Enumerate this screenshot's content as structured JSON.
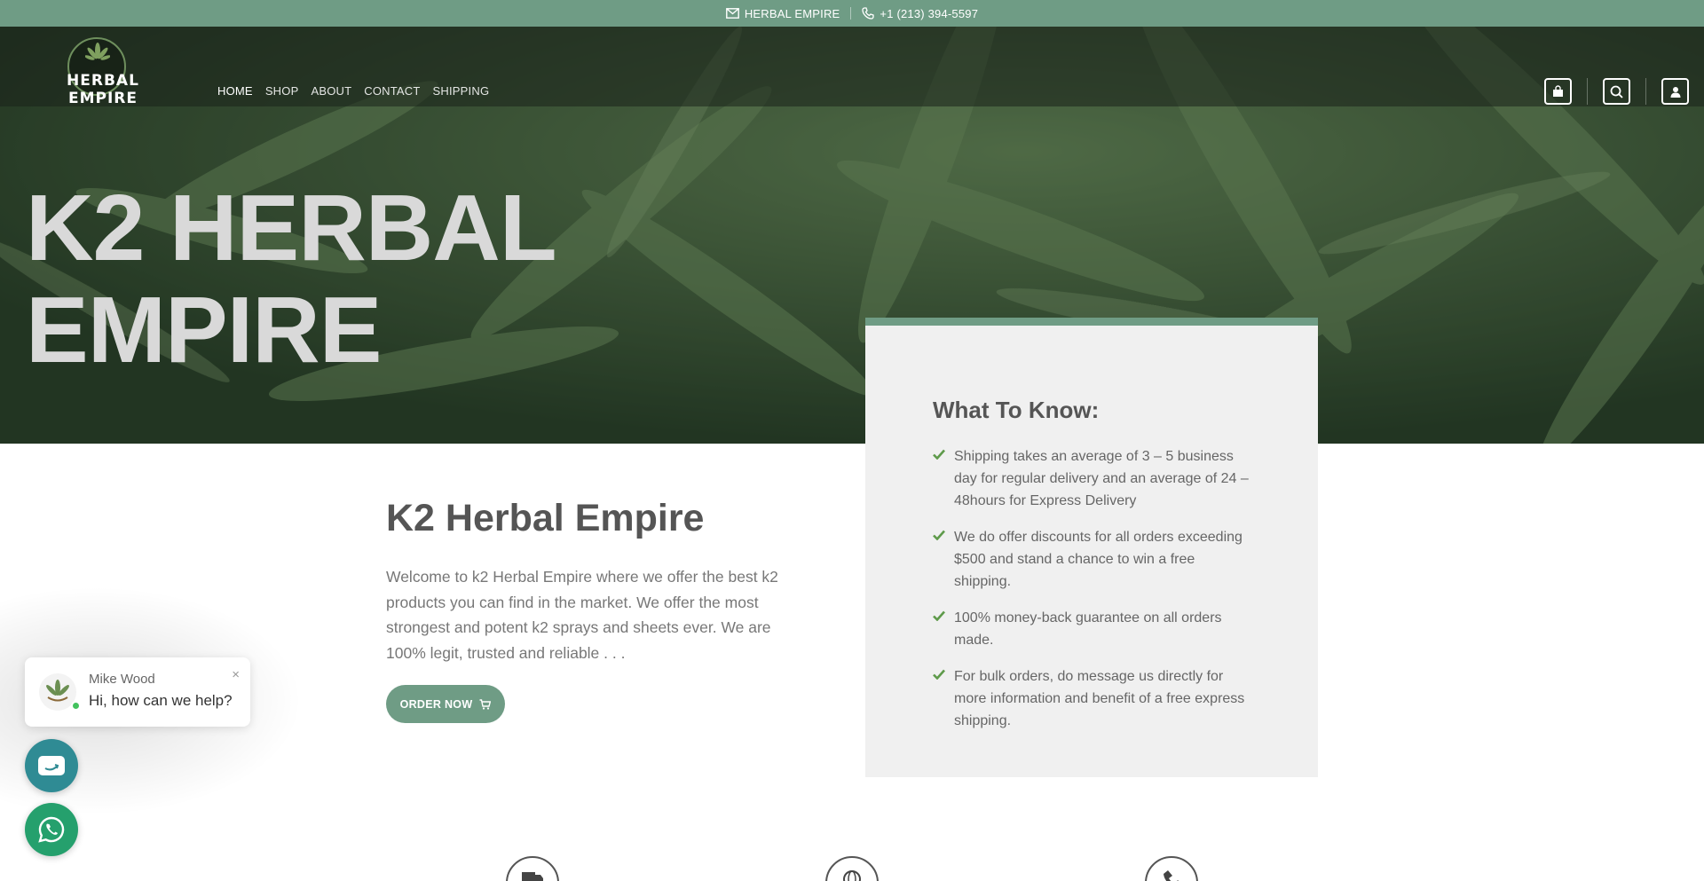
{
  "topbar": {
    "email_label": "HERBAL EMPIRE",
    "phone_label": "+1 (213) 394-5597",
    "icons": [
      "envelope-icon",
      "phone-icon"
    ]
  },
  "header": {
    "logo_text": "HERBAL  EMPIRE",
    "nav": [
      {
        "label": "HOME",
        "active": true
      },
      {
        "label": "SHOP",
        "active": false
      },
      {
        "label": "ABOUT",
        "active": false
      },
      {
        "label": "CONTACT",
        "active": false
      },
      {
        "label": "SHIPPING",
        "active": false
      }
    ],
    "icons": [
      "cart-icon",
      "search-icon",
      "user-icon"
    ]
  },
  "hero": {
    "title_line1": "K2 HERBAL",
    "title_line2": "EMPIRE"
  },
  "info_box": {
    "title": "What To Know:",
    "items": [
      "Shipping takes an average of 3 – 5 business day for regular delivery and an average of 24 – 48hours for Express Delivery",
      "We do offer discounts for all orders exceeding $500 and stand a chance to win a free shipping.",
      "100% money-back guarantee on all orders made.",
      "For bulk orders, do message us directly for more information and benefit of a free express shipping."
    ]
  },
  "main": {
    "title": "K2 Herbal Empire",
    "text": "Welcome to k2 Herbal Empire where we offer the best k2 products you can find in the market. We offer the most strongest and potent k2 sprays and sheets ever. We are 100% legit, trusted and reliable . . .",
    "order_button": "ORDER NOW"
  },
  "chat": {
    "agent_name": "Mike Wood",
    "message": "Hi, how can we help?",
    "close": "×"
  },
  "colors": {
    "accent": "#6f9c85",
    "check": "#5e9a4a",
    "whatsapp": "#25a06d",
    "chat_button": "#2f8b94"
  }
}
